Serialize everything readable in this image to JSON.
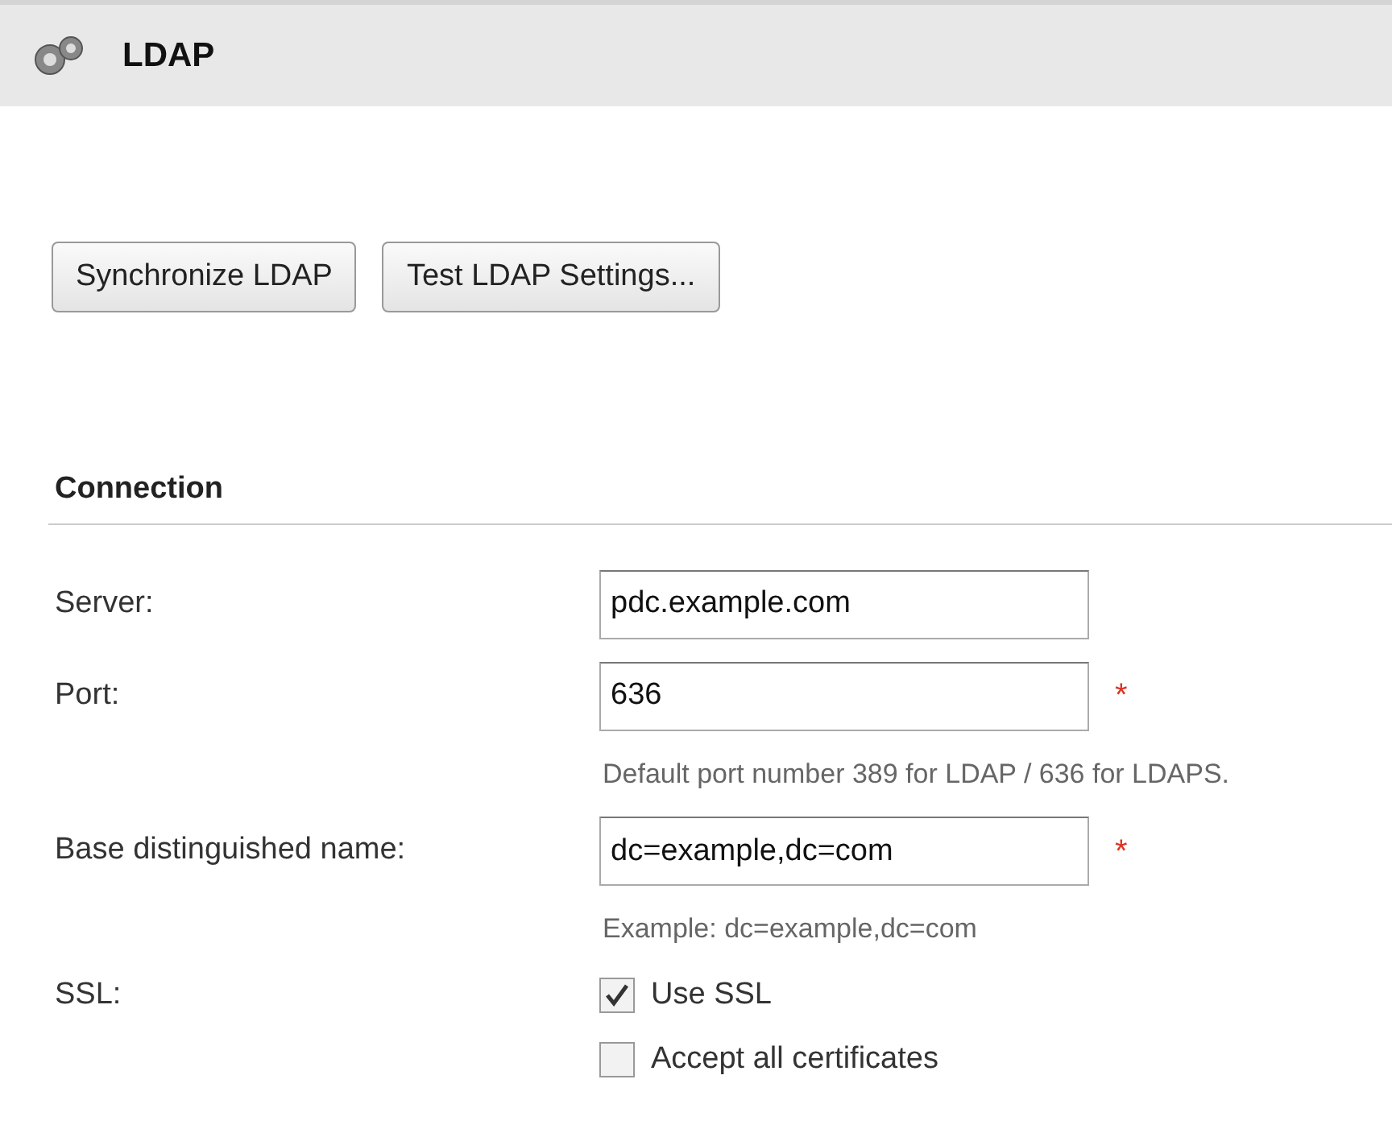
{
  "header": {
    "title": "LDAP"
  },
  "buttons": [
    "Synchronize LDAP",
    "Test LDAP Settings..."
  ],
  "section": {
    "title": "Connection"
  },
  "fields": [
    {
      "label": "Server:",
      "value": "pdc.example.com"
    },
    {
      "label": "Port:",
      "value": "636",
      "required_mark": "*",
      "hint": "Default port number 389 for LDAP / 636 for LDAPS."
    },
    {
      "label": "Base distinguished name:",
      "value": "dc=example,dc=com",
      "required_mark": "*",
      "hint": "Example: dc=example,dc=com"
    }
  ],
  "ssl": {
    "label": "SSL:",
    "options": [
      {
        "label": "Use SSL",
        "checked": true
      },
      {
        "label": "Accept all certificates",
        "checked": false
      }
    ]
  }
}
